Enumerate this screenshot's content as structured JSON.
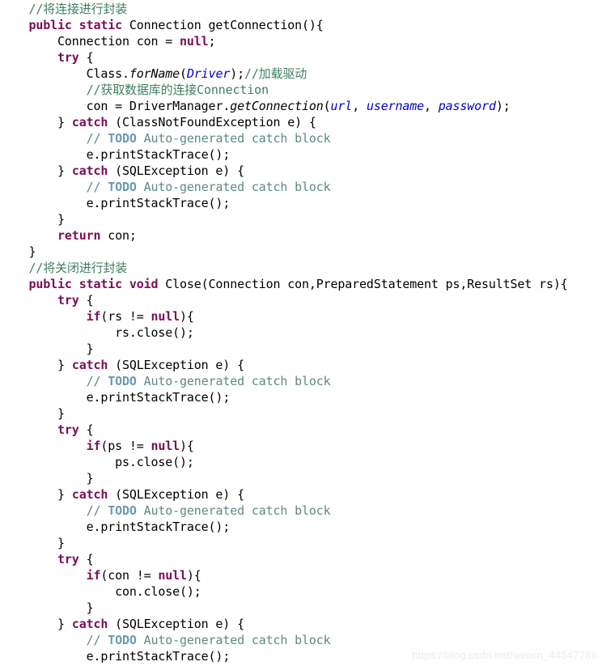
{
  "document": {
    "kind": "java-source-code-screenshot",
    "background_color": "#ffffff",
    "watermark": "https://blog.csdn.net/weixin_44547786",
    "syntax_colors": {
      "plain": "#000000",
      "keyword": "#7b0e55",
      "comment": "#3f7f5f",
      "todo_tag": "#6a9ab5",
      "todo_text": "#5d8a86",
      "static_field": "#0000cc",
      "method_name": "#000000"
    },
    "lines": [
      {
        "n": 1,
        "indent": 1,
        "tokens": [
          {
            "t": "comment",
            "s": "//将连接进行封装"
          }
        ]
      },
      {
        "n": 2,
        "indent": 1,
        "tokens": [
          {
            "t": "keyword",
            "s": "public static"
          },
          {
            "t": "plain",
            "s": " Connection getConnection(){"
          }
        ]
      },
      {
        "n": 3,
        "indent": 2,
        "tokens": [
          {
            "t": "plain",
            "s": "Connection con = "
          },
          {
            "t": "keyword",
            "s": "null"
          },
          {
            "t": "plain",
            "s": ";"
          }
        ]
      },
      {
        "n": 4,
        "indent": 2,
        "tokens": [
          {
            "t": "keyword",
            "s": "try"
          },
          {
            "t": "plain",
            "s": " {"
          }
        ]
      },
      {
        "n": 5,
        "indent": 3,
        "tokens": [
          {
            "t": "plain",
            "s": "Class."
          },
          {
            "t": "method",
            "s": "forName"
          },
          {
            "t": "plain",
            "s": "("
          },
          {
            "t": "field",
            "s": "Driver"
          },
          {
            "t": "plain",
            "s": ");"
          },
          {
            "t": "comment",
            "s": "//加载驱动"
          }
        ]
      },
      {
        "n": 6,
        "indent": 3,
        "tokens": [
          {
            "t": "comment",
            "s": "//获取数据库的连接Connection"
          }
        ]
      },
      {
        "n": 7,
        "indent": 3,
        "tokens": [
          {
            "t": "plain",
            "s": "con = DriverManager."
          },
          {
            "t": "method",
            "s": "getConnection"
          },
          {
            "t": "plain",
            "s": "("
          },
          {
            "t": "field",
            "s": "url"
          },
          {
            "t": "plain",
            "s": ", "
          },
          {
            "t": "field",
            "s": "username"
          },
          {
            "t": "plain",
            "s": ", "
          },
          {
            "t": "field",
            "s": "password"
          },
          {
            "t": "plain",
            "s": ");"
          }
        ]
      },
      {
        "n": 8,
        "indent": 2,
        "tokens": [
          {
            "t": "plain",
            "s": "} "
          },
          {
            "t": "keyword",
            "s": "catch"
          },
          {
            "t": "plain",
            "s": " (ClassNotFoundException e) {"
          }
        ]
      },
      {
        "n": 9,
        "indent": 3,
        "tokens": [
          {
            "t": "todotext",
            "s": "// "
          },
          {
            "t": "todo",
            "s": "TODO"
          },
          {
            "t": "todotext",
            "s": " Auto-generated catch block"
          }
        ]
      },
      {
        "n": 10,
        "indent": 3,
        "tokens": [
          {
            "t": "plain",
            "s": "e.printStackTrace();"
          }
        ]
      },
      {
        "n": 11,
        "indent": 2,
        "tokens": [
          {
            "t": "plain",
            "s": "} "
          },
          {
            "t": "keyword",
            "s": "catch"
          },
          {
            "t": "plain",
            "s": " (SQLException e) {"
          }
        ]
      },
      {
        "n": 12,
        "indent": 3,
        "tokens": [
          {
            "t": "todotext",
            "s": "// "
          },
          {
            "t": "todo",
            "s": "TODO"
          },
          {
            "t": "todotext",
            "s": " Auto-generated catch block"
          }
        ]
      },
      {
        "n": 13,
        "indent": 3,
        "tokens": [
          {
            "t": "plain",
            "s": "e.printStackTrace();"
          }
        ]
      },
      {
        "n": 14,
        "indent": 2,
        "tokens": [
          {
            "t": "plain",
            "s": "}"
          }
        ]
      },
      {
        "n": 15,
        "indent": 2,
        "tokens": [
          {
            "t": "keyword",
            "s": "return"
          },
          {
            "t": "plain",
            "s": " con;"
          }
        ]
      },
      {
        "n": 16,
        "indent": 1,
        "tokens": [
          {
            "t": "plain",
            "s": "}"
          }
        ]
      },
      {
        "n": 17,
        "indent": 1,
        "tokens": [
          {
            "t": "comment",
            "s": "//将关闭进行封装"
          }
        ]
      },
      {
        "n": 18,
        "indent": 1,
        "tokens": [
          {
            "t": "keyword",
            "s": "public static void"
          },
          {
            "t": "plain",
            "s": " Close(Connection con,PreparedStatement ps,ResultSet rs){"
          }
        ]
      },
      {
        "n": 19,
        "indent": 2,
        "tokens": [
          {
            "t": "keyword",
            "s": "try"
          },
          {
            "t": "plain",
            "s": " {"
          }
        ]
      },
      {
        "n": 20,
        "indent": 3,
        "tokens": [
          {
            "t": "keyword",
            "s": "if"
          },
          {
            "t": "plain",
            "s": "(rs != "
          },
          {
            "t": "keyword",
            "s": "null"
          },
          {
            "t": "plain",
            "s": "){"
          }
        ]
      },
      {
        "n": 21,
        "indent": 4,
        "tokens": [
          {
            "t": "plain",
            "s": "rs.close();"
          }
        ]
      },
      {
        "n": 22,
        "indent": 3,
        "tokens": [
          {
            "t": "plain",
            "s": "}"
          }
        ]
      },
      {
        "n": 23,
        "indent": 2,
        "tokens": [
          {
            "t": "plain",
            "s": "} "
          },
          {
            "t": "keyword",
            "s": "catch"
          },
          {
            "t": "plain",
            "s": " (SQLException e) {"
          }
        ]
      },
      {
        "n": 24,
        "indent": 3,
        "tokens": [
          {
            "t": "todotext",
            "s": "// "
          },
          {
            "t": "todo",
            "s": "TODO"
          },
          {
            "t": "todotext",
            "s": " Auto-generated catch block"
          }
        ]
      },
      {
        "n": 25,
        "indent": 3,
        "tokens": [
          {
            "t": "plain",
            "s": "e.printStackTrace();"
          }
        ]
      },
      {
        "n": 26,
        "indent": 2,
        "tokens": [
          {
            "t": "plain",
            "s": "}"
          }
        ]
      },
      {
        "n": 27,
        "indent": 2,
        "tokens": [
          {
            "t": "keyword",
            "s": "try"
          },
          {
            "t": "plain",
            "s": " {"
          }
        ]
      },
      {
        "n": 28,
        "indent": 3,
        "tokens": [
          {
            "t": "keyword",
            "s": "if"
          },
          {
            "t": "plain",
            "s": "(ps != "
          },
          {
            "t": "keyword",
            "s": "null"
          },
          {
            "t": "plain",
            "s": "){"
          }
        ]
      },
      {
        "n": 29,
        "indent": 4,
        "tokens": [
          {
            "t": "plain",
            "s": "ps.close();"
          }
        ]
      },
      {
        "n": 30,
        "indent": 3,
        "tokens": [
          {
            "t": "plain",
            "s": "}"
          }
        ]
      },
      {
        "n": 31,
        "indent": 2,
        "tokens": [
          {
            "t": "plain",
            "s": "} "
          },
          {
            "t": "keyword",
            "s": "catch"
          },
          {
            "t": "plain",
            "s": " (SQLException e) {"
          }
        ]
      },
      {
        "n": 32,
        "indent": 3,
        "tokens": [
          {
            "t": "todotext",
            "s": "// "
          },
          {
            "t": "todo",
            "s": "TODO"
          },
          {
            "t": "todotext",
            "s": " Auto-generated catch block"
          }
        ]
      },
      {
        "n": 33,
        "indent": 3,
        "tokens": [
          {
            "t": "plain",
            "s": "e.printStackTrace();"
          }
        ]
      },
      {
        "n": 34,
        "indent": 2,
        "tokens": [
          {
            "t": "plain",
            "s": "}"
          }
        ]
      },
      {
        "n": 35,
        "indent": 2,
        "tokens": [
          {
            "t": "keyword",
            "s": "try"
          },
          {
            "t": "plain",
            "s": " {"
          }
        ]
      },
      {
        "n": 36,
        "indent": 3,
        "tokens": [
          {
            "t": "keyword",
            "s": "if"
          },
          {
            "t": "plain",
            "s": "(con != "
          },
          {
            "t": "keyword",
            "s": "null"
          },
          {
            "t": "plain",
            "s": "){"
          }
        ]
      },
      {
        "n": 37,
        "indent": 4,
        "tokens": [
          {
            "t": "plain",
            "s": "con.close();"
          }
        ]
      },
      {
        "n": 38,
        "indent": 3,
        "tokens": [
          {
            "t": "plain",
            "s": "}"
          }
        ]
      },
      {
        "n": 39,
        "indent": 2,
        "tokens": [
          {
            "t": "plain",
            "s": "} "
          },
          {
            "t": "keyword",
            "s": "catch"
          },
          {
            "t": "plain",
            "s": " (SQLException e) {"
          }
        ]
      },
      {
        "n": 40,
        "indent": 3,
        "tokens": [
          {
            "t": "todotext",
            "s": "// "
          },
          {
            "t": "todo",
            "s": "TODO"
          },
          {
            "t": "todotext",
            "s": " Auto-generated catch block"
          }
        ]
      },
      {
        "n": 41,
        "indent": 3,
        "tokens": [
          {
            "t": "plain",
            "s": "e.printStackTrace();"
          }
        ]
      }
    ]
  }
}
